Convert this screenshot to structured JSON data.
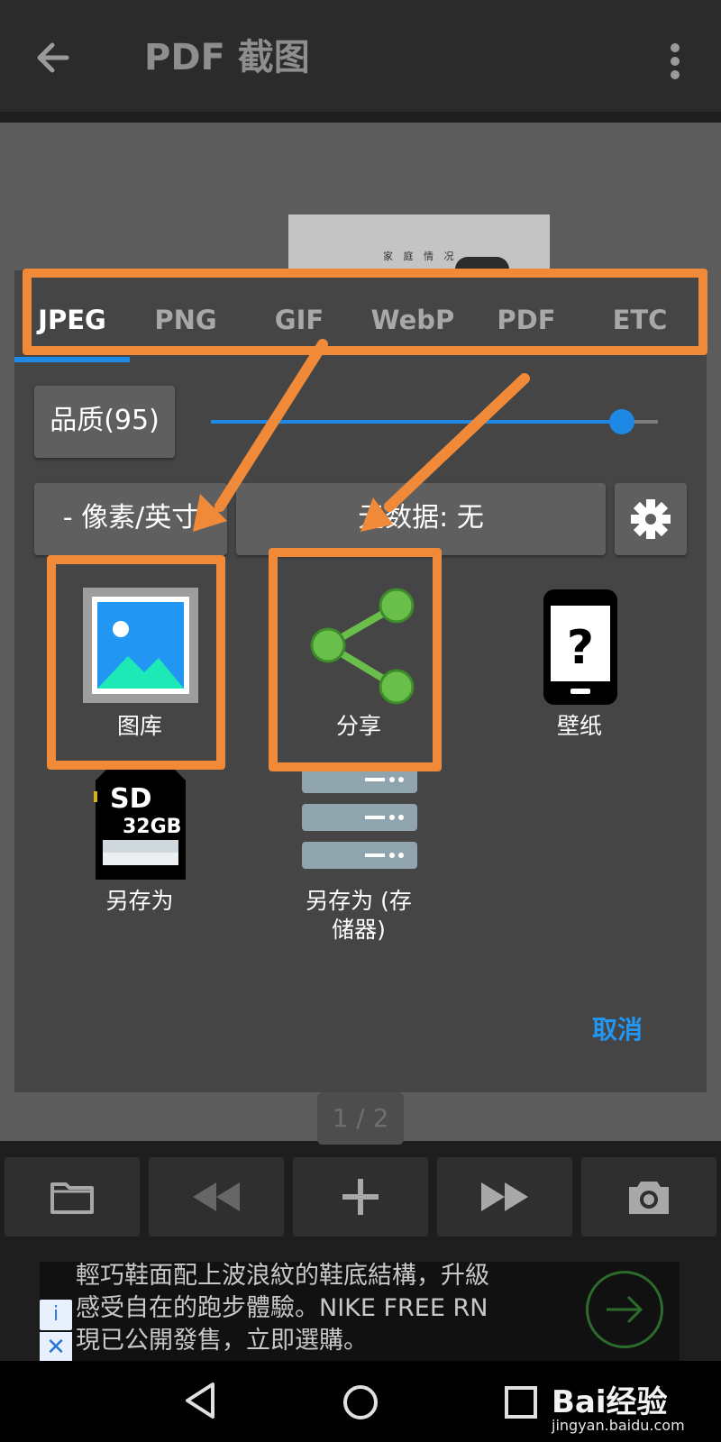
{
  "app_bar": {
    "title": "PDF 截图",
    "back_icon": "arrow-left-icon",
    "menu_icon": "more-vert-icon"
  },
  "document": {
    "thumbnail_text": "家 庭 情 况"
  },
  "dialog": {
    "tabs": [
      {
        "label": "JPEG",
        "active": true
      },
      {
        "label": "PNG",
        "active": false
      },
      {
        "label": "GIF",
        "active": false
      },
      {
        "label": "WebP",
        "active": false
      },
      {
        "label": "PDF",
        "active": false
      },
      {
        "label": "ETC",
        "active": false
      }
    ],
    "quality": {
      "label": "品质(95)",
      "value": 95,
      "slider_fraction": 0.92
    },
    "dpi_label": "- 像素/英寸",
    "metadata_label": "元数据: 无",
    "actions": [
      {
        "label": "图库",
        "icon": "gallery-icon"
      },
      {
        "label": "分享",
        "icon": "share-icon"
      },
      {
        "label": "壁纸",
        "icon": "phone-question-icon"
      },
      {
        "label": "另存为",
        "icon": "sd-card-icon",
        "sd_text": "SD",
        "sd_capacity": "32GB"
      },
      {
        "label": "另存为 (存储器)",
        "label_line1": "另存为 (存",
        "label_line2": "储器)",
        "icon": "server-storage-icon"
      }
    ],
    "cancel_label": "取消"
  },
  "pager": {
    "text": "1 / 2"
  },
  "toolbar": {
    "items": [
      "folder-icon",
      "rewind-icon",
      "add-icon",
      "fast-forward-icon",
      "camera-icon"
    ]
  },
  "ad": {
    "line1": "輕巧鞋面配上波浪紋的鞋底結構，升級",
    "line2": "感受自在的跑步體驗。NIKE FREE RN",
    "line3": "現已公開發售，立即選購。",
    "info_glyph": "i",
    "close_glyph": "✕"
  },
  "watermark": {
    "brand": "Bai经验",
    "url": "jingyan.baidu.com"
  },
  "colors": {
    "accent": "#1e88e5",
    "highlight": "#f08a38",
    "share_green": "#6abf4b",
    "cancel_blue": "#2196f3"
  }
}
